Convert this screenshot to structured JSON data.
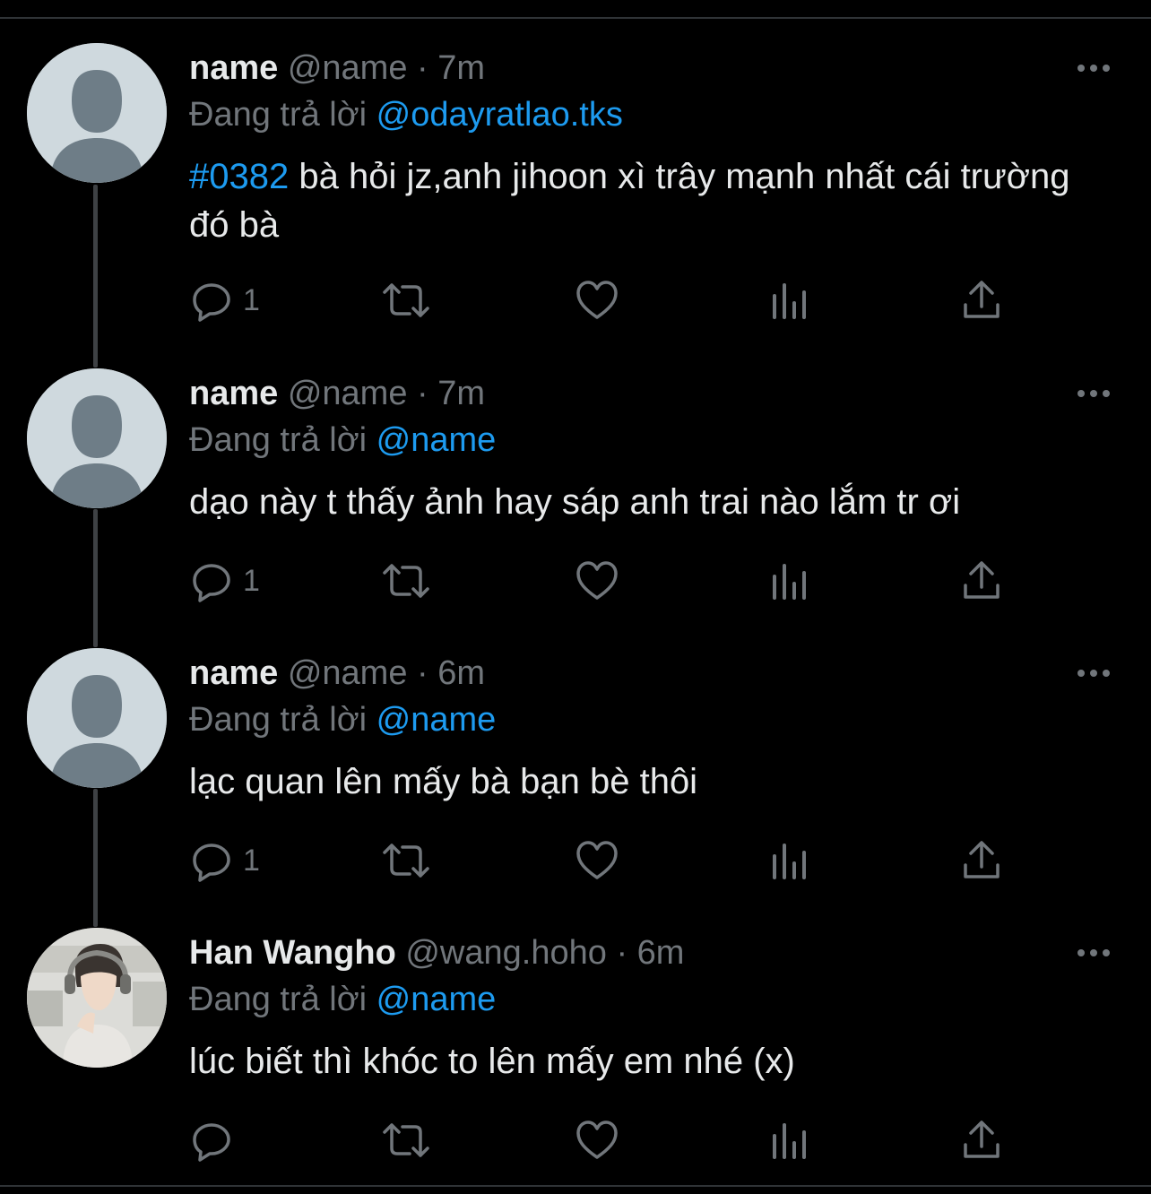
{
  "tweets": [
    {
      "display_name": "name",
      "handle": "@name",
      "separator": "·",
      "time": "7m",
      "replying_prefix": "Đang trả lời",
      "replying_to": "@odayratlao.tks",
      "hashtag": "#0382",
      "text": " bà hỏi jz,anh jihoon xì trây mạnh nhất cái trường đó bà",
      "reply_count": "1",
      "avatar": "default-avatar-icon"
    },
    {
      "display_name": "name",
      "handle": "@name",
      "separator": "·",
      "time": "7m",
      "replying_prefix": "Đang trả lời",
      "replying_to": "@name",
      "text": "dạo này t thấy ảnh hay sáp anh trai nào lắm tr ơi",
      "reply_count": "1",
      "avatar": "default-avatar-icon"
    },
    {
      "display_name": "name",
      "handle": "@name",
      "separator": "·",
      "time": "6m",
      "replying_prefix": "Đang trả lời",
      "replying_to": "@name",
      "text": "lạc quan lên mấy bà bạn bè thôi",
      "reply_count": "1",
      "avatar": "default-avatar-icon"
    },
    {
      "display_name": "Han Wangho",
      "handle": "@wang.hoho",
      "separator": "·",
      "time": "6m",
      "replying_prefix": "Đang trả lời",
      "replying_to": "@name",
      "text": "lúc biết thì khóc to lên mấy em nhé (x)",
      "reply_count": "",
      "avatar": "user-photo-avatar"
    }
  ],
  "icons": {
    "reply": "reply-icon",
    "retweet": "retweet-icon",
    "like": "heart-icon",
    "views": "analytics-icon",
    "share": "share-icon",
    "more": "more-options-icon"
  },
  "colors": {
    "background": "#000000",
    "text": "#e7e9ea",
    "secondary": "#71767b",
    "accent": "#1d9bf0",
    "thread_line": "#3e4144"
  }
}
